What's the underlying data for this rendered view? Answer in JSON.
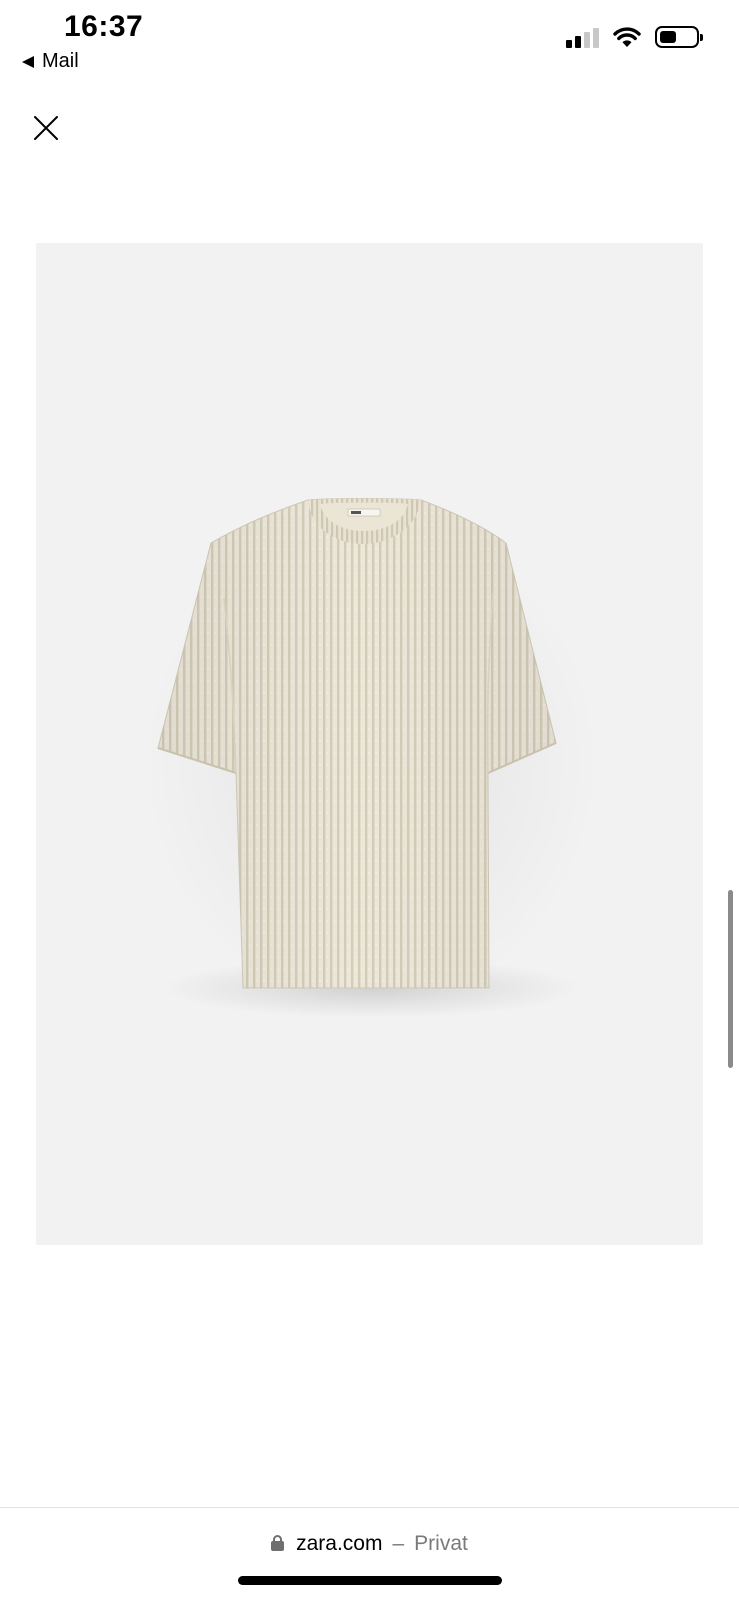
{
  "status_bar": {
    "time": "16:37",
    "back_label": "Mail",
    "icons": [
      "signal-icon",
      "wifi-icon",
      "battery-icon"
    ]
  },
  "modal": {
    "close_icon": "close-icon",
    "product_image": {
      "subject": "t-shirt",
      "background_color": "#f2f2f2",
      "garment_color": "#e6e0d0"
    }
  },
  "browser": {
    "domain": "zara.com",
    "separator": "–",
    "mode": "Privat"
  }
}
